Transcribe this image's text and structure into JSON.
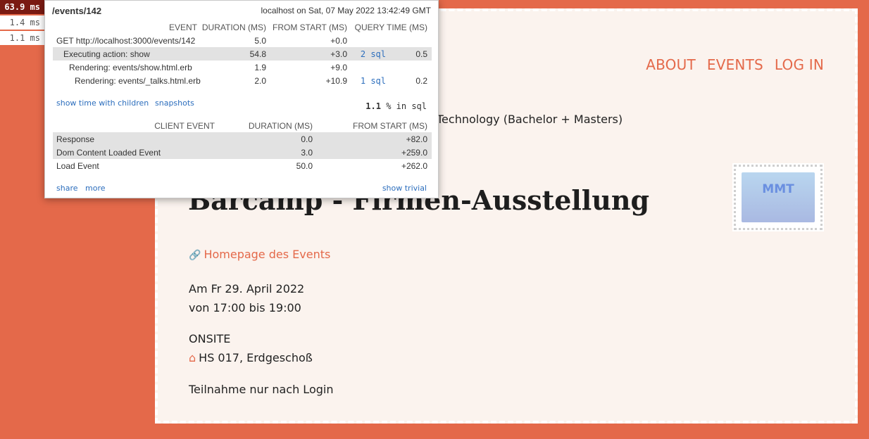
{
  "page": {
    "nav": [
      "ABOUT",
      "EVENTS",
      "LOG IN"
    ],
    "subtitle": "Technology (Bachelor + Masters)",
    "stamp_text": "MMT",
    "event_title": "Barcamp - Firmen-Ausstellung",
    "homepage_link": "Homepage des Events",
    "date_line": "Am Fr 29. April 2022",
    "time_line": "von 17:00 bis 19:00",
    "mode": "ONSITE",
    "location": "HS 017, Erdgeschoß",
    "participation": "Teilnahme nur nach Login",
    "accent_color": "#e4694a"
  },
  "profiler": {
    "badges": [
      "63.9 ms",
      "1.4 ms",
      "1.1 ms"
    ],
    "path": "/events/142",
    "timestamp": "localhost on Sat, 07 May 2022 13:42:49 GMT",
    "timing_headers": [
      "EVENT",
      "DURATION (MS)",
      "FROM START (MS)",
      "QUERY TIME (MS)"
    ],
    "timings": [
      {
        "name": "GET http://localhost:3000/events/142",
        "duration": "5.0",
        "from_start": "+0.0",
        "sql": "",
        "query_time": ""
      },
      {
        "name": "Executing action: show",
        "duration": "54.8",
        "from_start": "+3.0",
        "sql": "2 sql",
        "query_time": "0.5"
      },
      {
        "name": "Rendering: events/show.html.erb",
        "duration": "1.9",
        "from_start": "+9.0",
        "sql": "",
        "query_time": ""
      },
      {
        "name": "Rendering: events/_talks.html.erb",
        "duration": "2.0",
        "from_start": "+10.9",
        "sql": "1 sql",
        "query_time": "0.2"
      }
    ],
    "show_children_link": "show time with children",
    "snapshots_link": "snapshots",
    "sql_percent": "1.1",
    "sql_percent_suffix": "% in sql",
    "client_headers": [
      "CLIENT EVENT",
      "DURATION (MS)",
      "FROM START (MS)"
    ],
    "client_events": [
      {
        "name": "Response",
        "duration": "0.0",
        "from_start": "+82.0"
      },
      {
        "name": "Dom Content Loaded Event",
        "duration": "3.0",
        "from_start": "+259.0"
      },
      {
        "name": "Load Event",
        "duration": "50.0",
        "from_start": "+262.0"
      }
    ],
    "share_link": "share",
    "more_link": "more",
    "trivial_link": "show trivial"
  }
}
